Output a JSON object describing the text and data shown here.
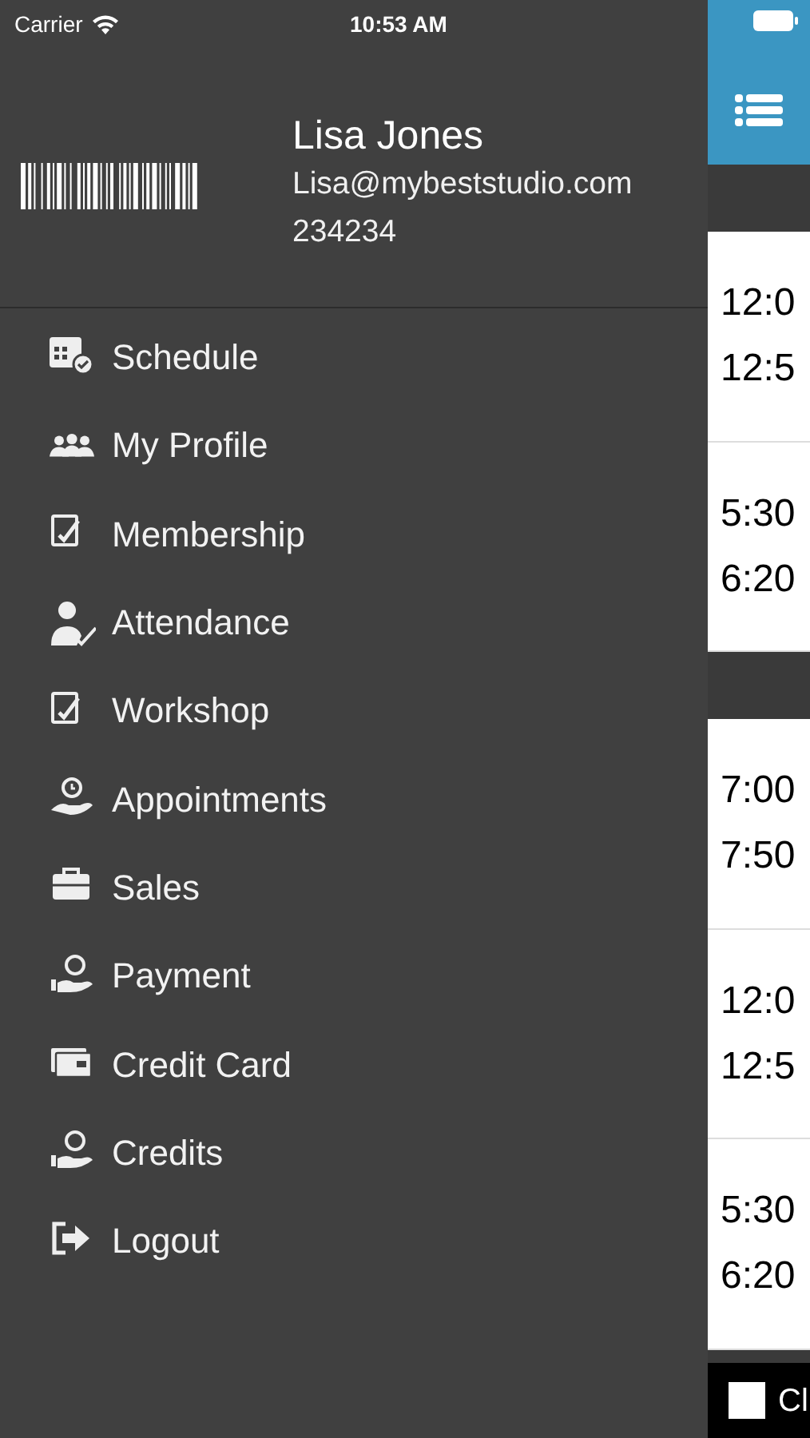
{
  "status_bar": {
    "carrier": "Carrier",
    "time": "10:53 AM"
  },
  "profile": {
    "name": "Lisa Jones",
    "email": "Lisa@mybeststudio.com",
    "id": "234234"
  },
  "menu": [
    {
      "label": "Schedule"
    },
    {
      "label": "My Profile"
    },
    {
      "label": "Membership"
    },
    {
      "label": "Attendance"
    },
    {
      "label": "Workshop"
    },
    {
      "label": "Appointments"
    },
    {
      "label": "Sales"
    },
    {
      "label": "Payment"
    },
    {
      "label": "Credit Card"
    },
    {
      "label": "Credits"
    },
    {
      "label": "Logout"
    }
  ],
  "schedule": [
    {
      "kind": "header"
    },
    {
      "kind": "row",
      "start": "12:0",
      "end": "12:5"
    },
    {
      "kind": "row",
      "start": "5:30",
      "end": "6:20"
    },
    {
      "kind": "header"
    },
    {
      "kind": "row",
      "start": "7:00",
      "end": "7:50"
    },
    {
      "kind": "row",
      "start": "12:0",
      "end": "12:5"
    },
    {
      "kind": "row",
      "start": "5:30",
      "end": "6:20"
    }
  ],
  "bottom_bar": {
    "checked": false,
    "label": "Cl"
  }
}
